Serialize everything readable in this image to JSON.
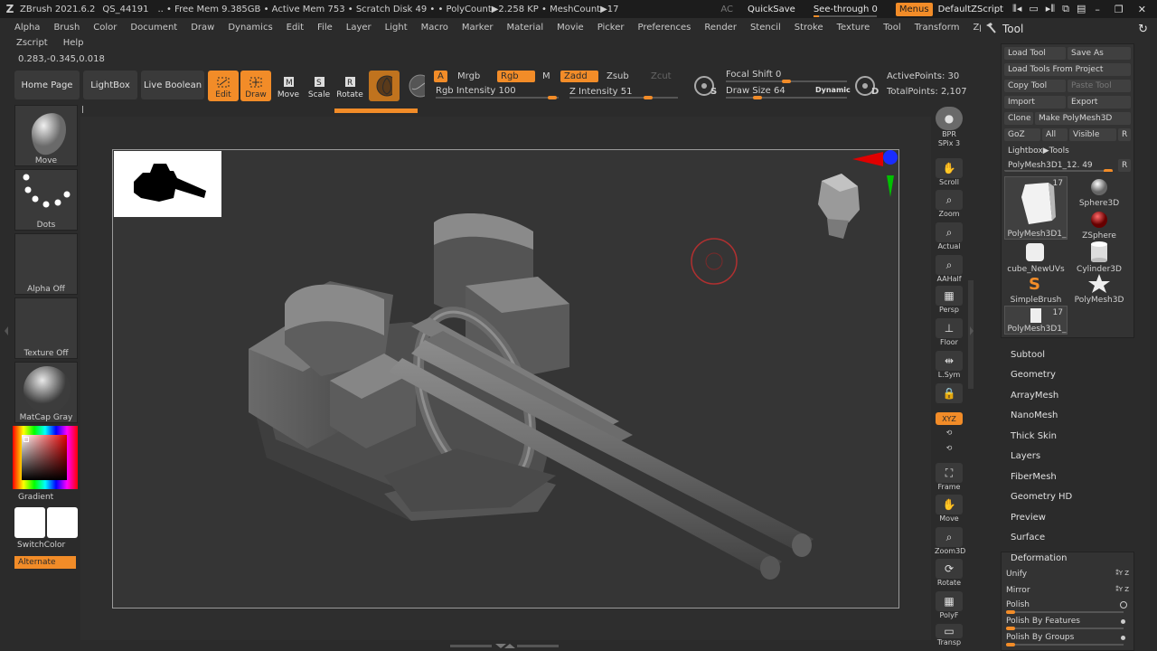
{
  "titlebar": {
    "app": "ZBrush 2021.6.2",
    "project": "QS_44191",
    "stats": ".. • Free Mem 9.385GB • Active Mem 753 • Scratch Disk 49 •  • PolyCount▶2.258 KP  • MeshCount▶17",
    "ac": "AC",
    "quicksave": "QuickSave",
    "see_through": "See-through  0",
    "menus": "Menus",
    "script": "DefaultZScript"
  },
  "menu": [
    "Alpha",
    "Brush",
    "Color",
    "Document",
    "Draw",
    "Dynamics",
    "Edit",
    "File",
    "Layer",
    "Light",
    "Macro",
    "Marker",
    "Material",
    "Movie",
    "Picker",
    "Preferences",
    "Render",
    "Stencil",
    "Stroke",
    "Texture",
    "Tool",
    "Transform",
    "Zplugin"
  ],
  "menu2": [
    "Zscript",
    "Help"
  ],
  "coords": "0.283,-0.345,0.018",
  "toolbar": {
    "home": "Home Page",
    "lightbox": "LightBox",
    "live_boolean": "Live Boolean",
    "edit": "Edit",
    "draw": "Draw",
    "move": "Move",
    "scale": "Scale",
    "rotate": "Rotate",
    "a": "A",
    "mrgb": "Mrgb",
    "rgb": "Rgb",
    "m": "M",
    "zadd": "Zadd",
    "zsub": "Zsub",
    "zcut": "Zcut",
    "rgb_intensity": "Rgb Intensity 100",
    "z_intensity": "Z Intensity 51",
    "focal_shift": "Focal Shift 0",
    "draw_size": "Draw Size 64",
    "dynamic": "Dynamic",
    "active_points": "ActivePoints: 30",
    "total_points": "TotalPoints: 2,107",
    "s_label": "S",
    "d_label": "D"
  },
  "shelf": {
    "move": "Move",
    "dots": "Dots",
    "alpha_off": "Alpha Off",
    "texture_off": "Texture Off",
    "matcap": "MatCap Gray",
    "gradient": "Gradient",
    "switchcolor": "SwitchColor",
    "alternate": "Alternate"
  },
  "right_toolbar": [
    {
      "label": "BPR"
    },
    {
      "label": "SPix 3"
    },
    {
      "label": "Scroll"
    },
    {
      "label": "Zoom"
    },
    {
      "label": "Actual"
    },
    {
      "label": "AAHalf"
    },
    {
      "label": "Persp"
    },
    {
      "label": "Floor"
    },
    {
      "label": "L.Sym"
    },
    {
      "label": "XYZ"
    },
    {
      "label": "Frame"
    },
    {
      "label": "Move"
    },
    {
      "label": "Zoom3D"
    },
    {
      "label": "Rotate"
    },
    {
      "label": "PolyF"
    },
    {
      "label": "Transp"
    }
  ],
  "tool_panel": {
    "title": "Tool",
    "load_tool": "Load Tool",
    "save_as": "Save As",
    "load_from_project": "Load Tools From Project",
    "copy_tool": "Copy Tool",
    "paste_tool": "Paste Tool",
    "import": "Import",
    "export": "Export",
    "clone": "Clone",
    "make_polymesh": "Make PolyMesh3D",
    "goz": "GoZ",
    "all": "All",
    "visible": "Visible",
    "r": "R",
    "lightbox_tools": "Lightbox▶Tools",
    "current_tool": "PolyMesh3D1_12. 49",
    "tools": [
      {
        "name": "PolyMesh3D1_",
        "badge": "17"
      },
      {
        "name": "Sphere3D",
        "badge": ""
      },
      {
        "name": "",
        "badge": ""
      },
      {
        "name": "ZSphere",
        "badge": ""
      },
      {
        "name": "cube_NewUVs",
        "badge": ""
      },
      {
        "name": "Cylinder3D",
        "badge": ""
      },
      {
        "name": "SimpleBrush",
        "badge": ""
      },
      {
        "name": "PolyMesh3D",
        "badge": ""
      },
      {
        "name": "PolyMesh3D1_",
        "badge": "17"
      }
    ],
    "sections": [
      "Subtool",
      "Geometry",
      "ArrayMesh",
      "NanoMesh",
      "Thick Skin",
      "Layers",
      "FiberMesh",
      "Geometry HD",
      "Preview",
      "Surface",
      "Deformation"
    ],
    "deformation": [
      "Unify",
      "Mirror",
      "Polish",
      "Polish By Features",
      "Polish By Groups"
    ]
  }
}
